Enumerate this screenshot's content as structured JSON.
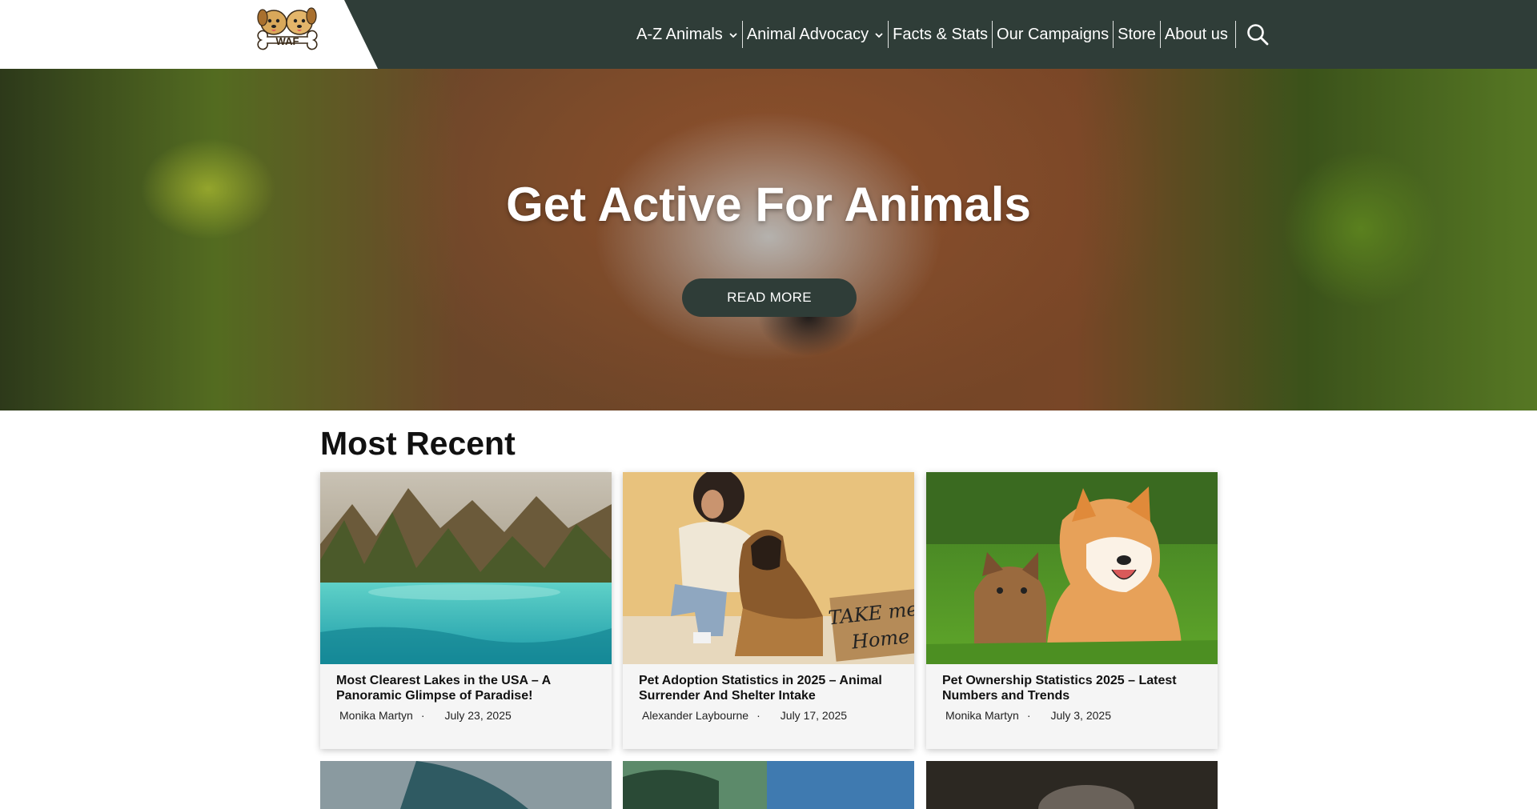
{
  "header": {
    "logo_text": "WAF",
    "nav": [
      {
        "label": "A-Z Animals",
        "dropdown": true
      },
      {
        "label": "Animal Advocacy",
        "dropdown": true
      },
      {
        "label": "Facts & Stats",
        "dropdown": false
      },
      {
        "label": "Our Campaigns",
        "dropdown": false
      },
      {
        "label": "Store",
        "dropdown": false
      },
      {
        "label": "About us",
        "dropdown": false
      }
    ],
    "search_icon": "search-icon",
    "colors": {
      "bar": "#2f3d38",
      "text": "#ffffff"
    }
  },
  "hero": {
    "title": "Get Active For Animals",
    "button_label": "READ MORE"
  },
  "recent": {
    "heading": "Most Recent",
    "posts": [
      {
        "title": "Most Clearest Lakes in the USA – A Panoramic Glimpse of Paradise!",
        "author": "Monika Martyn",
        "date": "July 23, 2025"
      },
      {
        "title": "Pet Adoption Statistics in 2025 – Animal Surrender And Shelter Intake",
        "author": "Alexander Laybourne",
        "date": "July 17, 2025",
        "image_sign": [
          "TAKE me",
          "Home"
        ]
      },
      {
        "title": "Pet Ownership Statistics 2025 – Latest Numbers and Trends",
        "author": "Monika Martyn",
        "date": "July 3, 2025"
      }
    ],
    "separator": "·"
  }
}
